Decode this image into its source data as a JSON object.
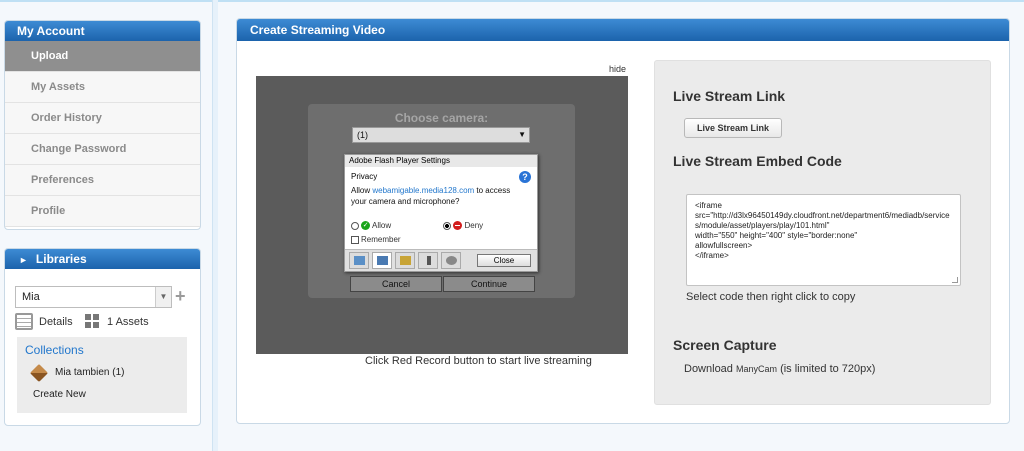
{
  "sidebar": {
    "account_title": "My Account",
    "account_items": [
      {
        "label": "Upload",
        "active": true
      },
      {
        "label": "My Assets",
        "active": false
      },
      {
        "label": "Order History",
        "active": false
      },
      {
        "label": "Change Password",
        "active": false
      },
      {
        "label": "Preferences",
        "active": false
      },
      {
        "label": "Profile",
        "active": false
      }
    ],
    "libraries": {
      "title": "Libraries",
      "selected_library": "Mia",
      "details_label": "Details",
      "assets_label": "1 Assets",
      "collections_title": "Collections",
      "collection_item": "Mia tambien (1)",
      "create_new": "Create New"
    }
  },
  "main": {
    "title": "Create Streaming Video",
    "hide_link": "hide",
    "video": {
      "choose_camera": "Choose camera:",
      "camera_value": "(1)",
      "flash_title": "Adobe Flash Player Settings",
      "privacy_label": "Privacy",
      "privacy_text_pre": "Allow ",
      "privacy_domain": "webamigable.media128.com",
      "privacy_text_post": " to access your camera and microphone?",
      "allow_label": "Allow",
      "deny_label": "Deny",
      "remember_label": "Remember",
      "close_label": "Close",
      "cancel_label": "Cancel",
      "continue_label": "Continue",
      "caption": "Click Red Record button to start live streaming"
    },
    "stream": {
      "live_link_heading": "Live Stream Link",
      "live_link_button": "Live Stream Link",
      "embed_heading": "Live Stream Embed Code",
      "embed_code": "<iframe\nsrc=\"http://d3lx96450149dy.cloudfront.net/department6/mediadb/services/module/asset/players/play/101.html\"\nwidth=\"550\" height=\"400\" style=\"border:none\"\nallowfullscreen>\n</iframe>",
      "copy_hint": "Select code then right click to copy",
      "capture_heading": "Screen Capture",
      "download_label": "Download",
      "download_app": "ManyCam",
      "download_note": "(is limited to 720px)"
    }
  },
  "colors": {
    "header_blue": "#1c63ac",
    "active_item": "#8f8f8f",
    "link_blue": "#2277cc"
  }
}
